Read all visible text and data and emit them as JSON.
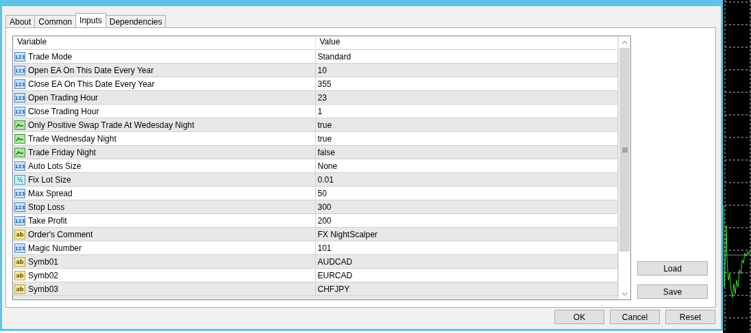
{
  "tabs": [
    {
      "label": "About",
      "selected": false
    },
    {
      "label": "Common",
      "selected": false
    },
    {
      "label": "Inputs",
      "selected": true
    },
    {
      "label": "Dependencies",
      "selected": false
    }
  ],
  "table": {
    "columns": [
      "Variable",
      "Value"
    ],
    "rows": [
      {
        "kind": "int",
        "icon": "123",
        "variable": "Trade Mode",
        "value": "Standard"
      },
      {
        "kind": "int",
        "icon": "123",
        "variable": "Open EA On This Date Every Year",
        "value": "10"
      },
      {
        "kind": "int",
        "icon": "123",
        "variable": "Close EA On This Date Every Year",
        "value": "355"
      },
      {
        "kind": "int",
        "icon": "123",
        "variable": "Open Trading Hour",
        "value": "23"
      },
      {
        "kind": "int",
        "icon": "123",
        "variable": "Close Trading Hour",
        "value": "1"
      },
      {
        "kind": "bool",
        "variable": "Only Positive Swap Trade At Wedesday Night",
        "value": "true"
      },
      {
        "kind": "bool",
        "variable": "Trade Wednesday Night",
        "value": "true"
      },
      {
        "kind": "bool",
        "variable": "Trade Friday Night",
        "value": "false"
      },
      {
        "kind": "int",
        "icon": "123",
        "variable": "Auto Lots Size",
        "value": "None"
      },
      {
        "kind": "double",
        "icon": "½",
        "variable": "Fix Lot Size",
        "value": "0.01"
      },
      {
        "kind": "int",
        "icon": "123",
        "variable": "Max Spread",
        "value": "50"
      },
      {
        "kind": "int",
        "icon": "123",
        "variable": "Stop Loss",
        "value": "300"
      },
      {
        "kind": "int",
        "icon": "123",
        "variable": "Take Profit",
        "value": "200"
      },
      {
        "kind": "string",
        "icon": "ab",
        "variable": "Order's Comment",
        "value": "FX NightScalper"
      },
      {
        "kind": "int",
        "icon": "123",
        "variable": "Magic Number",
        "value": "101"
      },
      {
        "kind": "string",
        "icon": "ab",
        "variable": "Symb01",
        "value": "AUDCAD"
      },
      {
        "kind": "string",
        "icon": "ab",
        "variable": "Symb02",
        "value": "EURCAD"
      },
      {
        "kind": "string",
        "icon": "ab",
        "variable": "Symb03",
        "value": "CHFJPY"
      }
    ]
  },
  "side_buttons": [
    "Load",
    "Save"
  ],
  "buttons": [
    "OK",
    "Cancel",
    "Reset"
  ]
}
